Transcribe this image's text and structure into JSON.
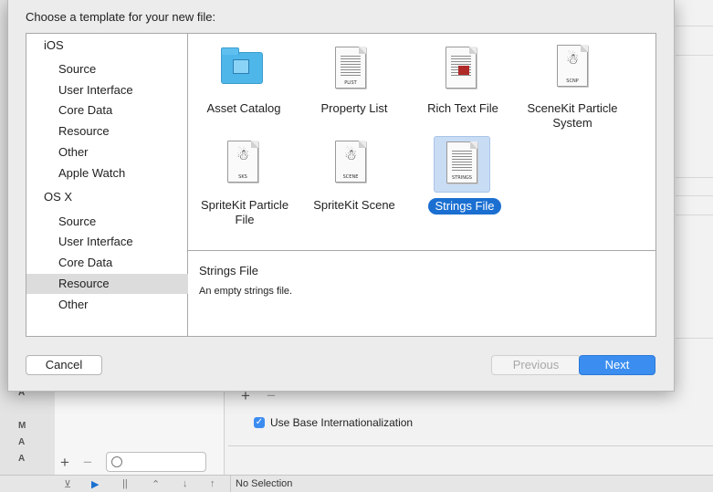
{
  "dialog": {
    "title": "Choose a template for your new file:",
    "cancel_label": "Cancel",
    "previous_label": "Previous",
    "next_label": "Next"
  },
  "categories": [
    {
      "label": "iOS",
      "kind": "section"
    },
    {
      "label": "Source",
      "kind": "sub"
    },
    {
      "label": "User Interface",
      "kind": "sub"
    },
    {
      "label": "Core Data",
      "kind": "sub"
    },
    {
      "label": "Resource",
      "kind": "sub"
    },
    {
      "label": "Other",
      "kind": "sub"
    },
    {
      "label": "Apple Watch",
      "kind": "sub"
    },
    {
      "label": "OS X",
      "kind": "section"
    },
    {
      "label": "Source",
      "kind": "sub"
    },
    {
      "label": "User Interface",
      "kind": "sub"
    },
    {
      "label": "Core Data",
      "kind": "sub"
    },
    {
      "label": "Resource",
      "kind": "sub",
      "selected": true
    },
    {
      "label": "Other",
      "kind": "sub"
    }
  ],
  "templates": [
    {
      "label": "Asset Catalog",
      "icon": "folder-icon"
    },
    {
      "label": "Property List",
      "icon": "document-icon",
      "tag": "PLIST"
    },
    {
      "label": "Rich Text File",
      "icon": "document-icon"
    },
    {
      "label": "SceneKit Particle System",
      "icon": "document-icon",
      "tag": "SCNP"
    },
    {
      "label": "SpriteKit Particle File",
      "icon": "document-icon",
      "tag": "SKS"
    },
    {
      "label": "SpriteKit Scene",
      "icon": "document-icon",
      "tag": "SCENE"
    },
    {
      "label": "Strings File",
      "icon": "document-icon",
      "tag": "STRINGS",
      "selected": true
    }
  ],
  "description": {
    "title": "Strings File",
    "text": "An empty strings file."
  },
  "background": {
    "letters": [
      "A",
      "M",
      "A",
      "A"
    ],
    "use_base_label": "Use Base Internationalization",
    "status_text": "No Selection"
  },
  "colors": {
    "accent": "#3b8ef0",
    "selection_pill": "#1a6fd1",
    "selected_icon_bg": "#c8dcf4",
    "folder": "#4fb6ea"
  }
}
